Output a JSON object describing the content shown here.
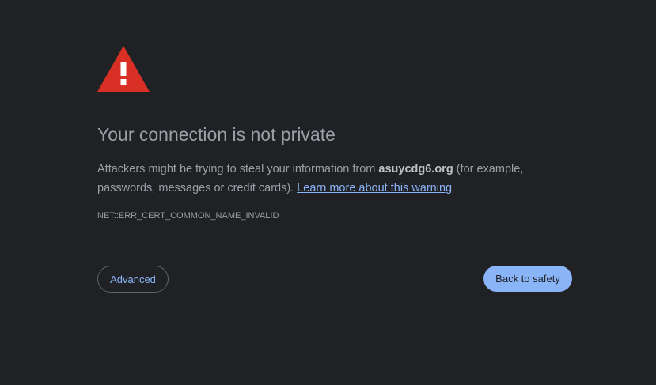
{
  "page": {
    "title": "Your connection is not private",
    "message_prefix": "Attackers might be trying to steal your information from ",
    "domain": "asuycdg6.org",
    "message_suffix": " (for example, passwords, messages or credit cards). ",
    "learn_more": "Learn more about this warning",
    "error_code": "NET::ERR_CERT_COMMON_NAME_INVALID"
  },
  "buttons": {
    "advanced": "Advanced",
    "back_to_safety": "Back to safety"
  },
  "icons": {
    "warning": "warning-triangle-icon"
  },
  "colors": {
    "background": "#202124",
    "warning_red": "#d93025",
    "link_blue": "#8ab4f8",
    "text_grey": "#9aa0a6"
  }
}
